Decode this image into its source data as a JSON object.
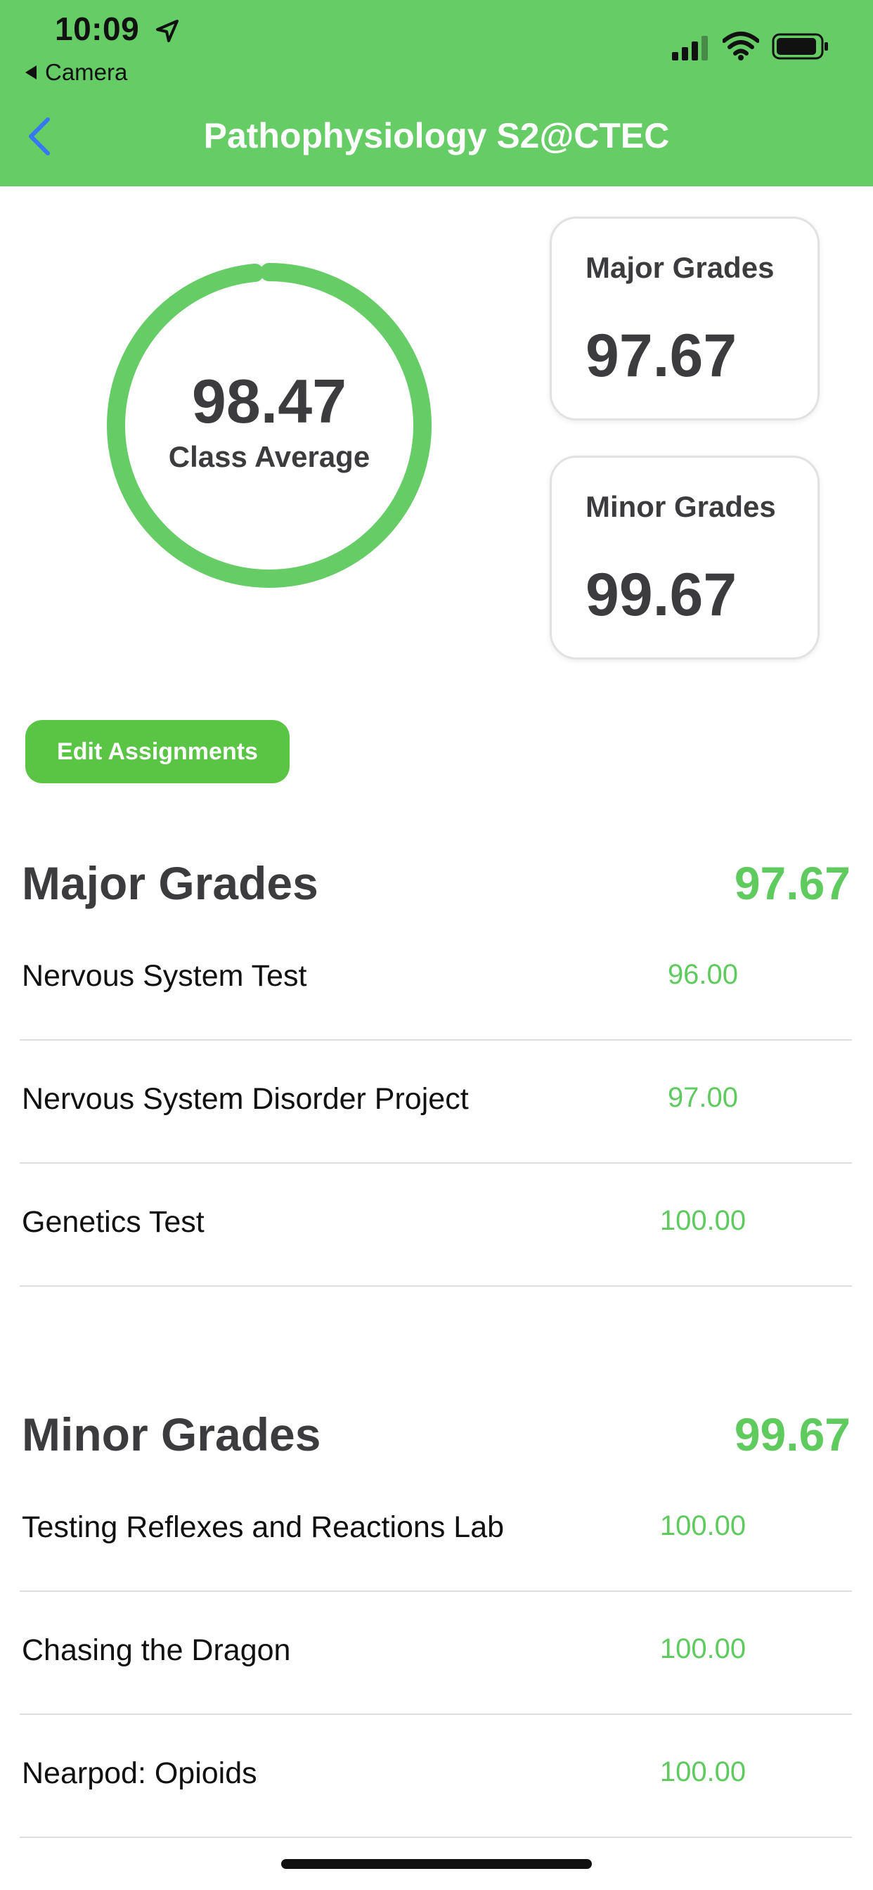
{
  "status_bar": {
    "time": "10:09",
    "back_app": "Camera"
  },
  "nav": {
    "title": "Pathophysiology S2@CTEC"
  },
  "summary": {
    "class_average_value": "98.47",
    "class_average_label": "Class Average",
    "class_average_fraction": 0.9847,
    "major_card": {
      "label": "Major Grades",
      "value": "97.67"
    },
    "minor_card": {
      "label": "Minor Grades",
      "value": "99.67"
    }
  },
  "actions": {
    "edit_label": "Edit Assignments"
  },
  "colors": {
    "header_bg": "#66cc66",
    "accent_green": "#5fcb5f",
    "button_green": "#5ac545",
    "back_chevron": "#3478f6"
  },
  "major": {
    "title": "Major Grades",
    "score": "97.67",
    "items": [
      {
        "name": "Nervous System Test",
        "score": "96.00"
      },
      {
        "name": "Nervous System Disorder Project",
        "score": "97.00"
      },
      {
        "name": "Genetics Test",
        "score": "100.00"
      }
    ]
  },
  "minor": {
    "title": "Minor Grades",
    "score": "99.67",
    "items": [
      {
        "name": "Testing Reflexes and Reactions Lab",
        "score": "100.00"
      },
      {
        "name": "Chasing the Dragon",
        "score": "100.00"
      },
      {
        "name": "Nearpod: Opioids",
        "score": "100.00"
      }
    ]
  }
}
